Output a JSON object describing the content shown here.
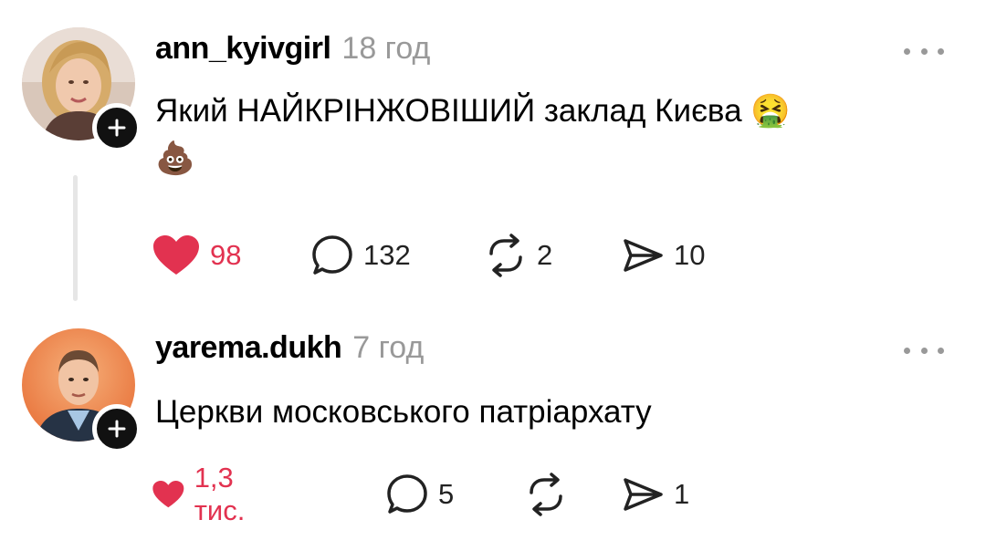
{
  "posts": [
    {
      "username": "ann_kyivgirl",
      "time": "18 год",
      "text": "Який НАЙКРІНЖОВІШИЙ заклад Києва",
      "emoji_1": "🤮",
      "emoji_2": "💩",
      "likes": "98",
      "comments": "132",
      "reposts": "2",
      "shares": "10",
      "liked": true
    },
    {
      "username": "yarema.dukh",
      "time": "7 год",
      "text": "Церкви московського патріархату",
      "likes": "1,3 тис.",
      "comments": "5",
      "reposts": "",
      "shares": "1",
      "liked": true
    }
  ],
  "colors": {
    "like": "#e23250",
    "muted": "#999999",
    "text": "#000000"
  },
  "icons": [
    "plus-icon",
    "more-icon",
    "heart-icon",
    "comment-icon",
    "repost-icon",
    "share-icon"
  ]
}
